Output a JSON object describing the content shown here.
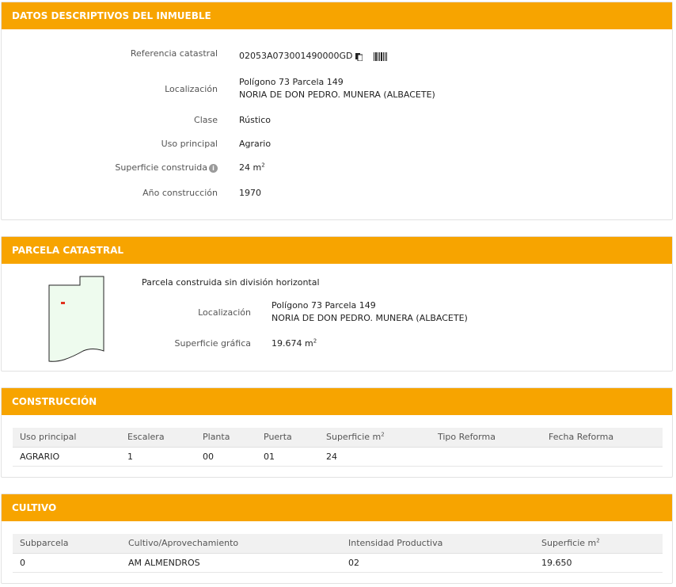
{
  "inmueble": {
    "header": "DATOS DESCRIPTIVOS DEL INMUEBLE",
    "ref_label": "Referencia catastral",
    "ref_value": "02053A073001490000GD",
    "loc_label": "Localización",
    "loc_line1": "Polígono 73 Parcela 149",
    "loc_line2": "NORIA DE DON PEDRO. MUNERA (ALBACETE)",
    "clase_label": "Clase",
    "clase_value": "Rústico",
    "uso_label": "Uso principal",
    "uso_value": "Agrario",
    "sup_label": "Superficie construida",
    "sup_value": "24 m",
    "sup_unit_sup": "2",
    "anio_label": "Año construcción",
    "anio_value": "1970"
  },
  "parcela": {
    "header": "PARCELA CATASTRAL",
    "desc": "Parcela construida sin división horizontal",
    "loc_label": "Localización",
    "loc_line1": "Polígono 73 Parcela 149",
    "loc_line2": "NORIA DE DON PEDRO. MUNERA (ALBACETE)",
    "sup_label": "Superficie gráfica",
    "sup_value": "19.674 m",
    "sup_unit_sup": "2"
  },
  "construccion": {
    "header": "CONSTRUCCIÓN",
    "columns": [
      "Uso principal",
      "Escalera",
      "Planta",
      "Puerta",
      "Superficie m",
      "Tipo Reforma",
      "Fecha Reforma"
    ],
    "sup_col_sup": "2",
    "rows": [
      [
        "AGRARIO",
        "1",
        "00",
        "01",
        "24",
        "",
        ""
      ]
    ]
  },
  "cultivo": {
    "header": "CULTIVO",
    "columns": [
      "Subparcela",
      "Cultivo/Aprovechamiento",
      "Intensidad Productiva",
      "Superficie m"
    ],
    "sup_col_sup": "2",
    "rows": [
      [
        "0",
        "AM ALMENDROS",
        "02",
        "19.650"
      ]
    ]
  },
  "icons": {
    "copy": "copy-icon",
    "barcode": "barcode-icon",
    "info": "info-icon",
    "parcel_map": "parcel-map"
  },
  "colors": {
    "accent": "#f7a400",
    "parcel_fill": "#eefbee",
    "building": "#e0301e"
  }
}
